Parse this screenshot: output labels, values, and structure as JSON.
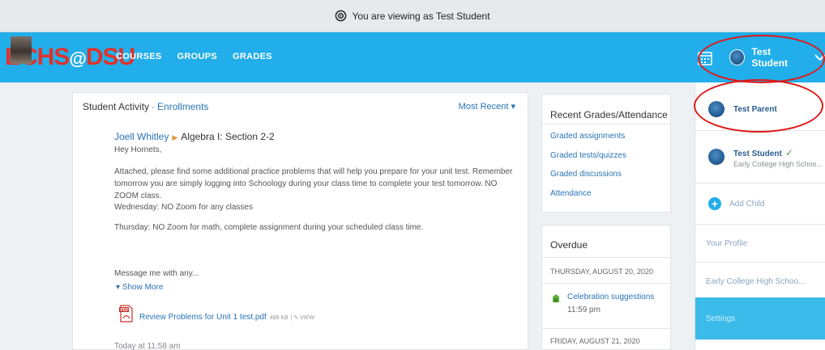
{
  "banner": {
    "text": "You are viewing as Test Student"
  },
  "nav": {
    "logo_left": "ECHS",
    "logo_at": "@",
    "logo_right": "DSU",
    "links": [
      "COURSES",
      "GROUPS",
      "GRADES"
    ],
    "user_name": "Test Student"
  },
  "activity": {
    "title": "Student Activity",
    "separator": "·",
    "enrollments": "Enrollments",
    "sort": "Most Recent ▾",
    "post": {
      "author": "Joell Whitley",
      "arrow": "▶",
      "course": "Algebra I: Section 2-2",
      "greeting": "Hey Hornets,",
      "body1": "Attached, please find some additional practice problems that will help you prepare for your unit test. Remember tomorrow you are simply logging into Schoology during your class time to complete your test tomorrow. NO ZOOM class.",
      "body2": "Wednesday: NO Zoom for any classes",
      "body3": "Thursday: NO Zoom for math, complete assignment during your scheduled class time.",
      "body4": "Message me with any...",
      "show_more": "▾ Show More",
      "attachment": "Review Problems for Unit 1 test.pdf",
      "attachment_size": "488 KB",
      "attachment_view": "| ✎ VIEW",
      "timestamp": "Today at 11:58 am"
    }
  },
  "grades": {
    "title": "Recent Grades/Attendance",
    "links": [
      "Graded assignments",
      "Graded tests/quizzes",
      "Graded discussions",
      "Attendance"
    ]
  },
  "overdue": {
    "title": "Overdue",
    "date1": "THURSDAY, AUGUST 20, 2020",
    "item1": "Celebration suggestions",
    "item1_time": "11:59 pm",
    "date2": "FRIDAY, AUGUST 21, 2020"
  },
  "dropdown": {
    "parent_name": "Test Parent",
    "student_name": "Test Student",
    "student_check": "✓",
    "student_school": "Early College High Schoo...",
    "add_child": "Add Child",
    "your_profile": "Your Profile",
    "school": "Early College High Schoo...",
    "settings": "Settings"
  },
  "colors": {
    "nav_bg": "#21aeea",
    "logo_red": "#e0312a",
    "link_blue": "#2a73b5",
    "annotation_red": "#e01818"
  }
}
